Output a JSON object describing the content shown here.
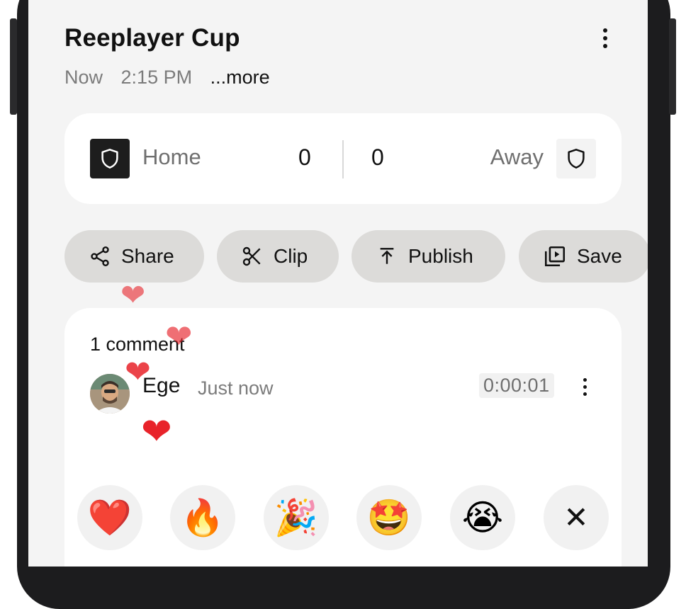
{
  "header": {
    "title": "Reeplayer Cup",
    "meta_day": "Now",
    "meta_time": "2:15 PM",
    "more_link": "...more"
  },
  "scoreboard": {
    "home_name": "Home",
    "home_score": "0",
    "away_score": "0",
    "away_name": "Away"
  },
  "actions": {
    "share": "Share",
    "clip": "Clip",
    "publish": "Publish",
    "save": "Save"
  },
  "comments": {
    "count_label": "1 comment",
    "items": [
      {
        "author": "Ege",
        "time_ago": "Just now",
        "timestamp": "0:00:01"
      }
    ]
  },
  "reactions": {
    "heart": "❤️",
    "fire": "🔥",
    "party": "🎉",
    "star_struck": "🤩",
    "crying": "😭",
    "close": "✕"
  },
  "floating_hearts": [
    "❤",
    "❤",
    "❤",
    "❤"
  ],
  "colors": {
    "screen_bg": "#f4f4f4",
    "card_bg": "#ffffff",
    "button_bg": "#dcdbd9",
    "heart_red": "#e8232a",
    "frame": "#1c1c1e"
  }
}
